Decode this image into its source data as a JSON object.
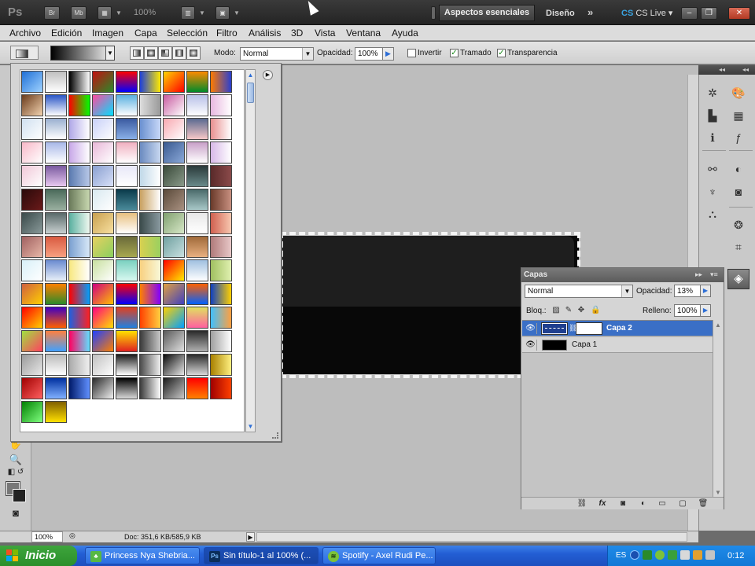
{
  "appbar": {
    "logo": "Ps",
    "bridge_label": "Br",
    "minibridge_label": "Mb",
    "zoom": "100%",
    "workspace_active": "Aspectos esenciales",
    "workspace_other": "Diseño",
    "more_label": "»",
    "cslive_label": "CS Live"
  },
  "menu": [
    "Archivo",
    "Edición",
    "Imagen",
    "Capa",
    "Selección",
    "Filtro",
    "Análisis",
    "3D",
    "Vista",
    "Ventana",
    "Ayuda"
  ],
  "options": {
    "mode_label": "Modo:",
    "mode_value": "Normal",
    "opacity_label": "Opacidad:",
    "opacity_value": "100%",
    "invert_label": "Invertir",
    "dither_label": "Tramado",
    "transparency_label": "Transparencia",
    "invert_checked": false,
    "dither_checked": true,
    "transparency_checked": true
  },
  "layers_panel": {
    "tab": "Capas",
    "blend_mode": "Normal",
    "opacity_label": "Opacidad:",
    "opacity_value": "13%",
    "lock_label": "Bloq.:",
    "fill_label": "Relleno:",
    "fill_value": "100%",
    "layers": [
      {
        "name": "Capa 2",
        "selected": true
      },
      {
        "name": "Capa 1",
        "selected": false
      }
    ]
  },
  "status": {
    "zoom": "100%",
    "doc": "Doc: 351,6 KB/585,9 KB"
  },
  "taskbar": {
    "start": "Inicio",
    "tasks": [
      {
        "label": "Princess Nya Shebria...",
        "icon": "messenger-icon"
      },
      {
        "label": "Sin título-1 al 100% (...",
        "icon": "photoshop-icon"
      },
      {
        "label": "Spotify - Axel Rudi Pe...",
        "icon": "spotify-icon"
      }
    ],
    "lang": "ES",
    "clock": "0:12"
  },
  "colors": {
    "selection": "#3a6fc6",
    "canvas_dark": "#1e1e1e",
    "canvas_black": "#080808"
  }
}
